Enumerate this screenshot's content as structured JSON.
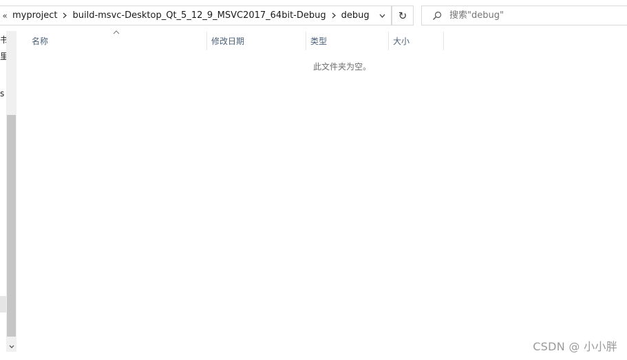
{
  "address_bar": {
    "overflow": "«",
    "crumbs": [
      "myproject",
      "build-msvc-Desktop_Qt_5_12_9_MSVC2017_64bit-Debug",
      "debug"
    ]
  },
  "refresh_glyph": "↻",
  "search": {
    "placeholder": "搜索\"debug\""
  },
  "nav_pane": {
    "items": [
      "书",
      "里",
      "s"
    ]
  },
  "columns": [
    "名称",
    "修改日期",
    "类型",
    "大小"
  ],
  "empty_message": "此文件夹为空。",
  "watermark": "CSDN @ 小小胖"
}
